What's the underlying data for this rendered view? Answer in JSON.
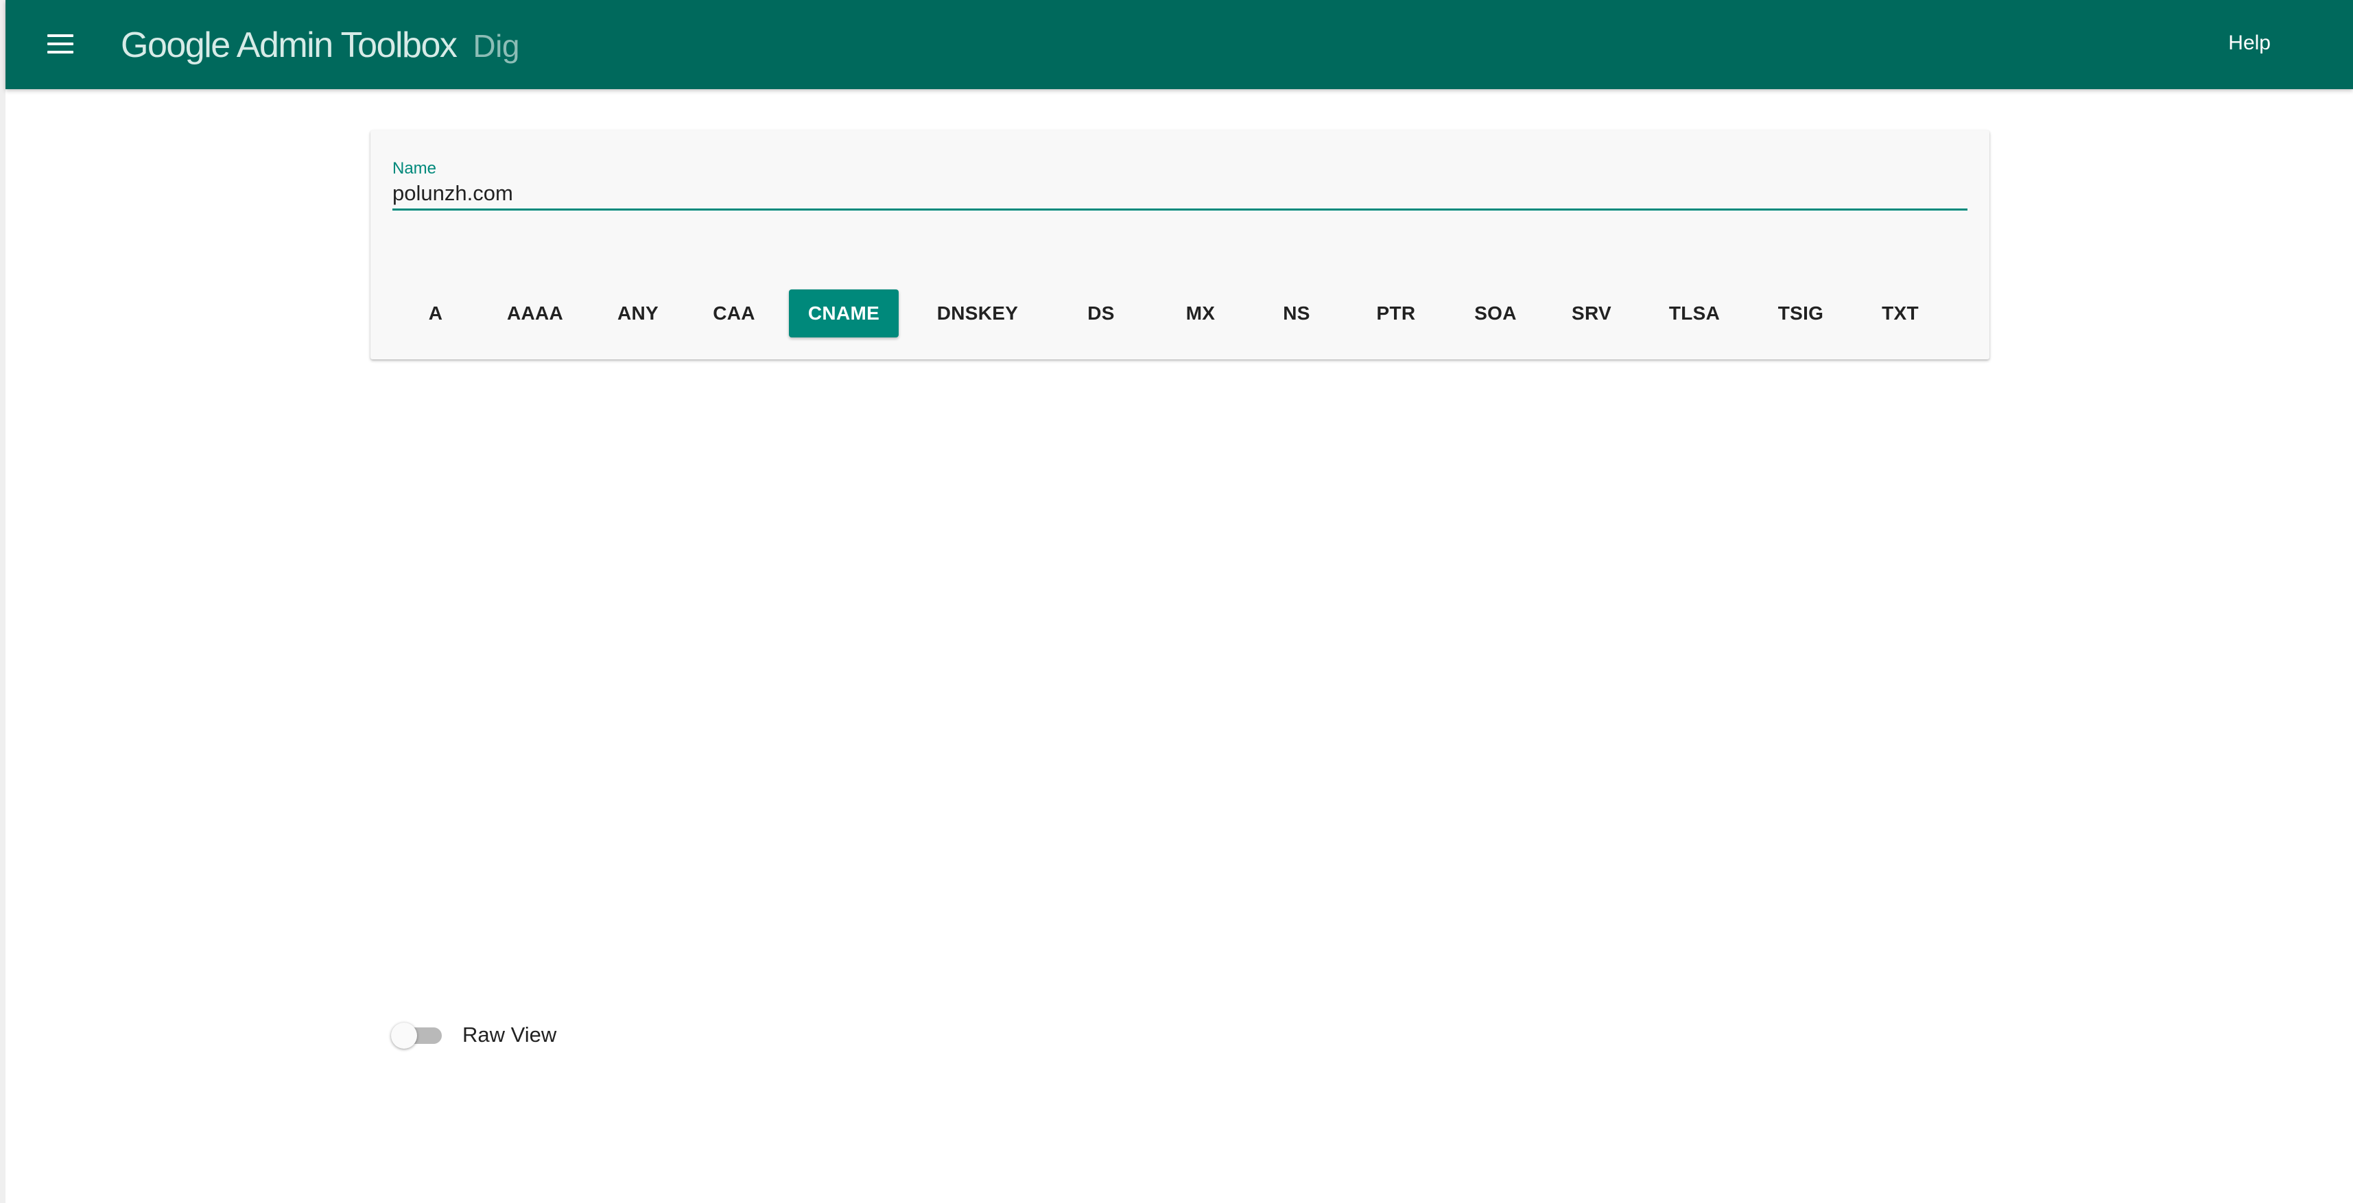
{
  "header": {
    "title": "Google Admin Toolbox",
    "subtitle": "Dig",
    "help_label": "Help",
    "menu_icon": "hamburger-menu-icon",
    "background_color": "#00695c"
  },
  "query": {
    "name_label": "Name",
    "name_value": "polunzh.com"
  },
  "record_types": [
    {
      "label": "A",
      "selected": false
    },
    {
      "label": "AAAA",
      "selected": false
    },
    {
      "label": "ANY",
      "selected": false
    },
    {
      "label": "CAA",
      "selected": false
    },
    {
      "label": "CNAME",
      "selected": true
    },
    {
      "label": "DNSKEY",
      "selected": false
    },
    {
      "label": "DS",
      "selected": false
    },
    {
      "label": "MX",
      "selected": false
    },
    {
      "label": "NS",
      "selected": false
    },
    {
      "label": "PTR",
      "selected": false
    },
    {
      "label": "SOA",
      "selected": false
    },
    {
      "label": "SRV",
      "selected": false
    },
    {
      "label": "TLSA",
      "selected": false
    },
    {
      "label": "TSIG",
      "selected": false
    },
    {
      "label": "TXT",
      "selected": false
    }
  ],
  "accent_color": "#00897b",
  "raw_view": {
    "label": "Raw View",
    "enabled": false
  }
}
